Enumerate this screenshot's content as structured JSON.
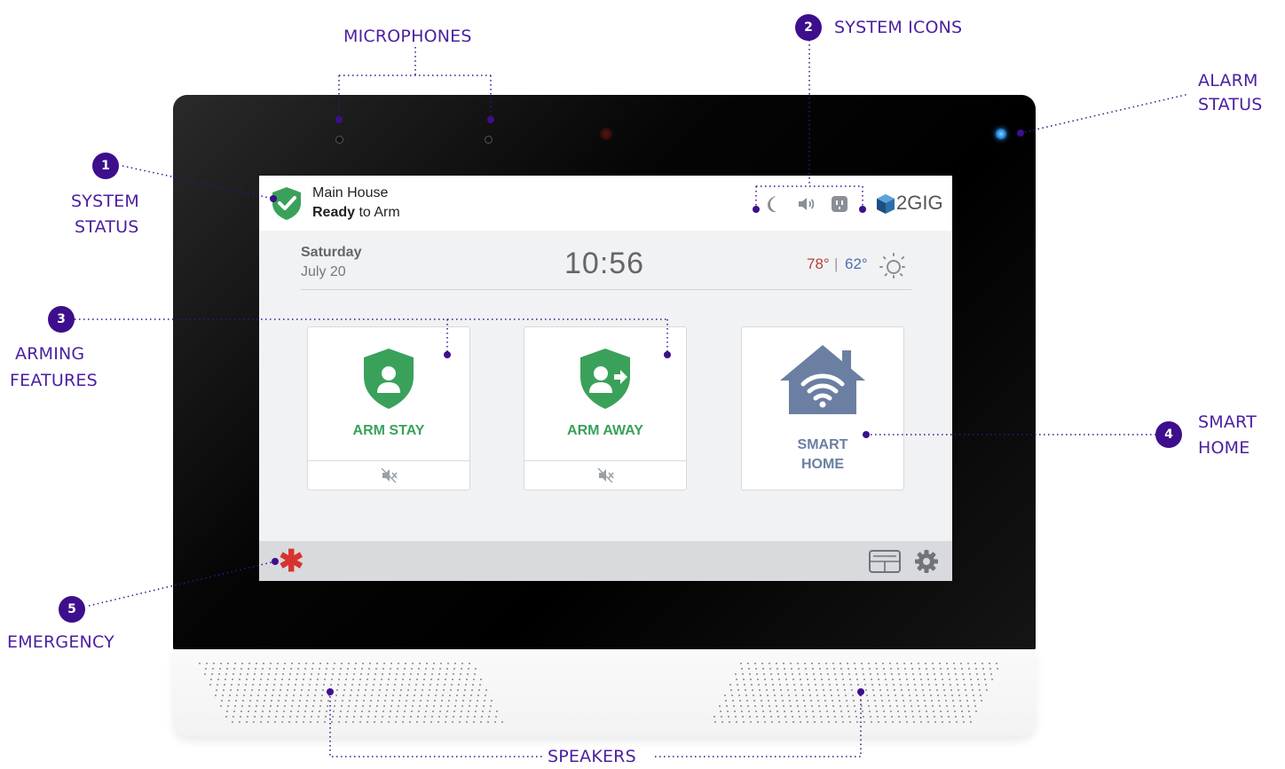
{
  "callouts": {
    "microphones": "MICROPHONES",
    "system_icons": "SYSTEM ICONS",
    "system_icons_num": "2",
    "alarm_status_1": "ALARM",
    "alarm_status_2": "STATUS",
    "system_status_num": "1",
    "system_status_1": "SYSTEM",
    "system_status_2": "STATUS",
    "arming_num": "3",
    "arming_1": "ARMING",
    "arming_2": "FEATURES",
    "smart_num": "4",
    "smart_1": "SMART",
    "smart_2": "HOME",
    "emergency_num": "5",
    "emergency": "EMERGENCY",
    "speakers": "SPEAKERS"
  },
  "screen": {
    "status": {
      "location": "Main House",
      "state_bold": "Ready",
      "state_rest": " to Arm"
    },
    "brand": "2GIG",
    "date": {
      "day": "Saturday",
      "month_day": "July 20"
    },
    "time": "10:56",
    "weather": {
      "high": "78°",
      "separator": "|",
      "low": "62°"
    },
    "tiles": {
      "arm_stay": "ARM STAY",
      "arm_away": "ARM AWAY",
      "smart_line1": "SMART",
      "smart_line2": "HOME"
    },
    "emergency_symbol": "✱"
  },
  "colors": {
    "callout": "#4b1fa0",
    "badge": "#3d0f8c",
    "shield_green": "#3aa15a",
    "smart_home_blue": "#6b7fa3",
    "emergency_red": "#d8332e"
  },
  "icons": [
    "check-shield-icon",
    "moon-icon",
    "speaker-icon",
    "outlet-icon",
    "logo-cube-icon",
    "sun-icon",
    "person-shield-icon",
    "person-arrow-shield-icon",
    "wifi-house-icon",
    "mute-icon",
    "keypad-icon",
    "gear-icon"
  ]
}
